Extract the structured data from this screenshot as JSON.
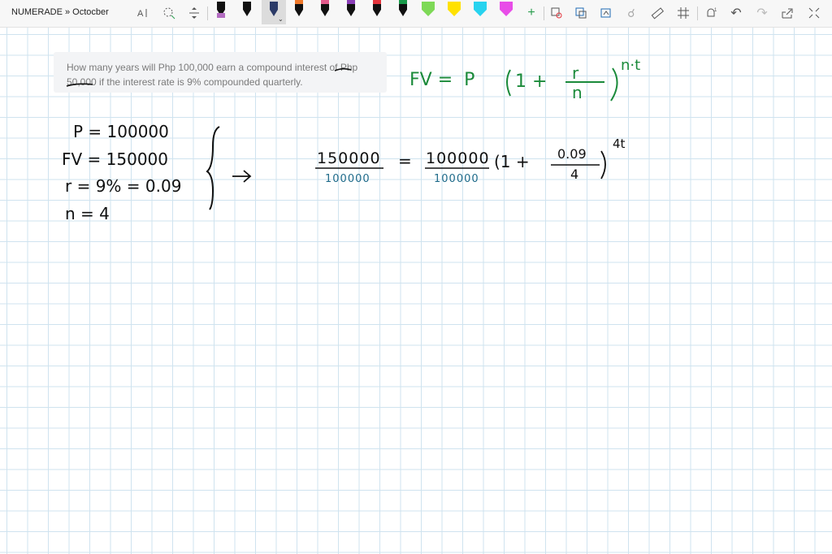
{
  "app": {
    "breadcrumb": "NUMERADE » Octocber"
  },
  "toolbar": {
    "tools": [
      "text-select-icon",
      "lasso-icon",
      "insert-space-icon"
    ],
    "pens": [
      {
        "name": "pen-violet",
        "band": "#b36cc1"
      },
      {
        "name": "pen-black",
        "band": "#111111"
      },
      {
        "name": "pen-dark-blue",
        "band": "#2b3a67",
        "selected": true
      },
      {
        "name": "pen-orange",
        "band": "#f0792b"
      },
      {
        "name": "pen-pink",
        "band": "#e35a8c"
      },
      {
        "name": "pen-purple",
        "band": "#8a3fb7"
      },
      {
        "name": "pen-red",
        "band": "#e3353d"
      },
      {
        "name": "pen-green",
        "band": "#1a9b4b"
      },
      {
        "name": "highlighter-green",
        "band": "#7ed957"
      },
      {
        "name": "highlighter-yellow",
        "band": "#ffe100"
      },
      {
        "name": "highlighter-cyan",
        "band": "#27d3ef"
      },
      {
        "name": "highlighter-magenta",
        "band": "#e84de8"
      }
    ],
    "right_tools": [
      "add-pen-icon",
      "ink-to-shape-icon",
      "ink-to-math-icon",
      "lasso-select-icon",
      "touch-write-icon",
      "ruler-icon",
      "grid-icon",
      "alert-icon",
      "undo-icon",
      "redo-icon",
      "share-icon",
      "fullscreen-icon"
    ]
  },
  "question": {
    "line1": "How many years will Php 100,000 earn a compound interest of Php",
    "line2": "50,000 if the interest rate is 9% compounded quarterly."
  },
  "handwriting": {
    "formula": "FV = P(1 + r/n)",
    "formula_exp": "n·t",
    "given": [
      "P = 100000",
      "FV = 150000",
      "r = 9% = 0.09",
      "n = 4"
    ],
    "eq_left_num": "150000",
    "eq_left_den": "100000",
    "eq_right_num": "100000",
    "eq_right_den": "100000",
    "eq_mid": "= ",
    "eq_inner": "(1 +",
    "eq_frac_num": "0.09",
    "eq_frac_den": "4",
    "eq_exp": "4t"
  },
  "colors": {
    "ink_black": "#111111",
    "ink_green": "#1a8a3a",
    "ink_blue": "#1f6b8a"
  }
}
